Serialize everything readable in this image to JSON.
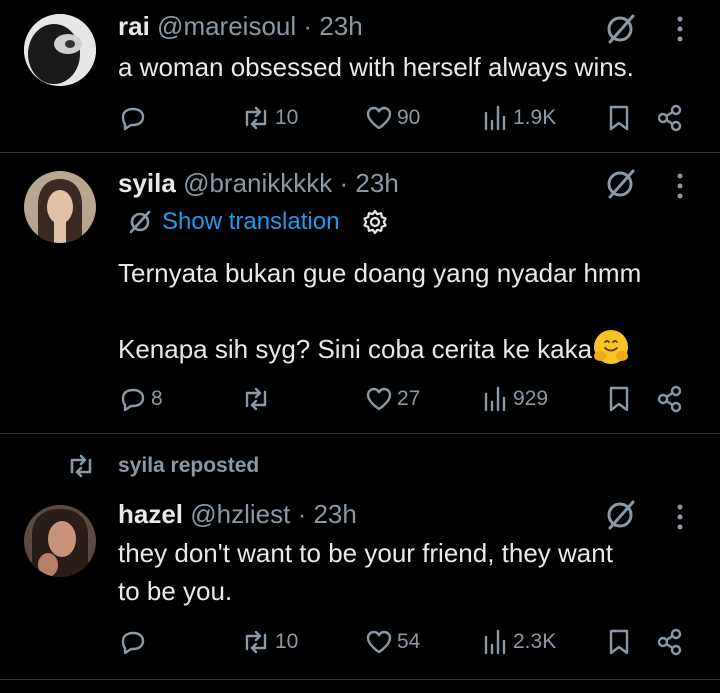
{
  "posts": [
    {
      "name": "rai",
      "handle": "@mareisoul",
      "time": "· 23h",
      "text": "a woman obsessed with herself always wins.",
      "replies": "",
      "reposts": "10",
      "likes": "90",
      "views": "1.9K"
    },
    {
      "name": "syila",
      "handle": "@branikkkkk",
      "time": "· 23h",
      "translate_label": "Show translation",
      "text_line1": "Ternyata bukan gue doang yang nyadar hmm",
      "text_line2": "Kenapa sih syg? Sini coba cerita ke kaka",
      "replies": "8",
      "reposts": "",
      "likes": "27",
      "views": "929"
    },
    {
      "reposted_by": "syila reposted",
      "name": "hazel",
      "handle": "@hzliest",
      "time": "· 23h",
      "text_line1": "they don't want to be your friend, they want",
      "text_line2": "to be you.",
      "replies": "",
      "reposts": "10",
      "likes": "54",
      "views": "2.3K"
    }
  ],
  "colors": {
    "background": "#000000",
    "text": "#e7e9ea",
    "muted": "#8b98a5",
    "link": "#1d9bf0",
    "divider": "#2f3336"
  },
  "icons": [
    "grok-icon",
    "more-icon",
    "reply-icon",
    "repost-icon",
    "like-icon",
    "views-icon",
    "bookmark-icon",
    "share-icon",
    "translate-icon",
    "gear-icon"
  ]
}
